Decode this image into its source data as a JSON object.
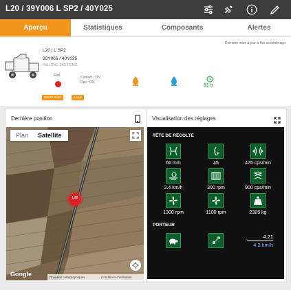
{
  "header": {
    "title": "L20 / 39Y006 L SP2 / 40Y025",
    "icons": [
      "sliders-icon",
      "satellite-icon",
      "info-icon",
      "edit-icon"
    ]
  },
  "tabs": [
    {
      "label": "Aperçu",
      "active": true
    },
    {
      "label": "Statistiques",
      "active": false
    },
    {
      "label": "Composants",
      "active": false
    },
    {
      "label": "Alertes",
      "active": false
    }
  ],
  "machine": {
    "updated": "Dernière mise à jour à five seconds ago",
    "model": "L20 / L SP2",
    "serial": "39Y006 / 40Y025",
    "owner": "PELLENC SAS DEMO",
    "status_label": "Etat",
    "contact_label": "Contact : ON",
    "duc_label": "Duc : ON",
    "flow_value": "81 h",
    "badge_year": "DEMO 2024",
    "badge_speed": "0 kn/h",
    "colors": {
      "accent": "#f3951c",
      "status_dot": "#e02020",
      "oil": "#f3951c",
      "water": "#2aa0d8",
      "green": "#3bb54a"
    }
  },
  "position_panel": {
    "title": "Dernière position",
    "map_tabs": [
      "Plan",
      "Satellite"
    ],
    "active_map_tab": "Satellite",
    "marker_label": "L20",
    "google_label": "Google",
    "footer_links": [
      "Données cartographiques",
      "Conditions d'utilisation"
    ]
  },
  "settings_panel": {
    "title": "Visualisation des réglages",
    "harvest_section": "TÊTE DE RÉCOLTE",
    "harvest_tiles": [
      {
        "icon": "shaker-icon",
        "value": "60 mm"
      },
      {
        "icon": "angle-icon",
        "value": "45"
      },
      {
        "icon": "frequency-icon",
        "value": "476 cps/min"
      },
      {
        "icon": "speed-icon",
        "value": "2.4 km/h"
      },
      {
        "icon": "conveyor-icon",
        "value": "300 rpm"
      },
      {
        "icon": "sorter-icon",
        "value": "900 cps/min"
      },
      {
        "icon": "fan-icon",
        "value": "1300 rpm"
      },
      {
        "icon": "fan2-icon",
        "value": "1100 rpm"
      },
      {
        "icon": "weight-icon",
        "value": "2325 kg"
      }
    ],
    "carrier_section": "PORTEUR",
    "carrier_value_top": "4.21",
    "carrier_value_bottom": "4.2 km/h"
  }
}
